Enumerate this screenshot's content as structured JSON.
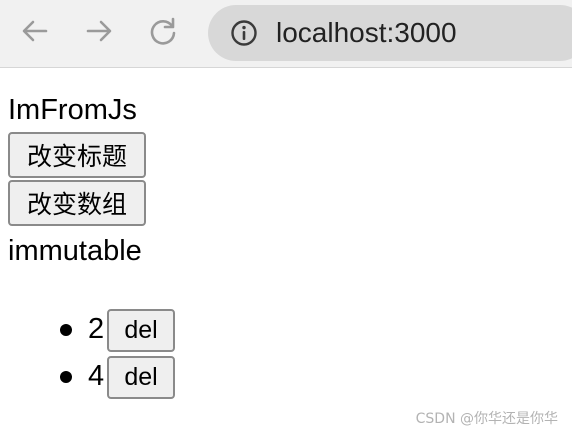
{
  "browser": {
    "url": "localhost:3000",
    "icons": {
      "back": "arrow-left-icon",
      "forward": "arrow-right-icon",
      "reload": "reload-icon",
      "info": "info-icon"
    }
  },
  "page": {
    "title": "ImFromJs",
    "change_title_button": "改变标题",
    "change_array_button": "改变数组",
    "immutable_label": "immutable",
    "items": [
      {
        "value": "2",
        "delete_label": "del"
      },
      {
        "value": "4",
        "delete_label": "del"
      }
    ]
  },
  "watermark": "CSDN @你华还是你华",
  "colors": {
    "toolbar_bg": "#f1f1f1",
    "address_bar_bg": "#d8d8d8",
    "button_bg": "#efefef",
    "button_border": "#8a8a8a",
    "icon_gray": "#9a9a9a"
  }
}
